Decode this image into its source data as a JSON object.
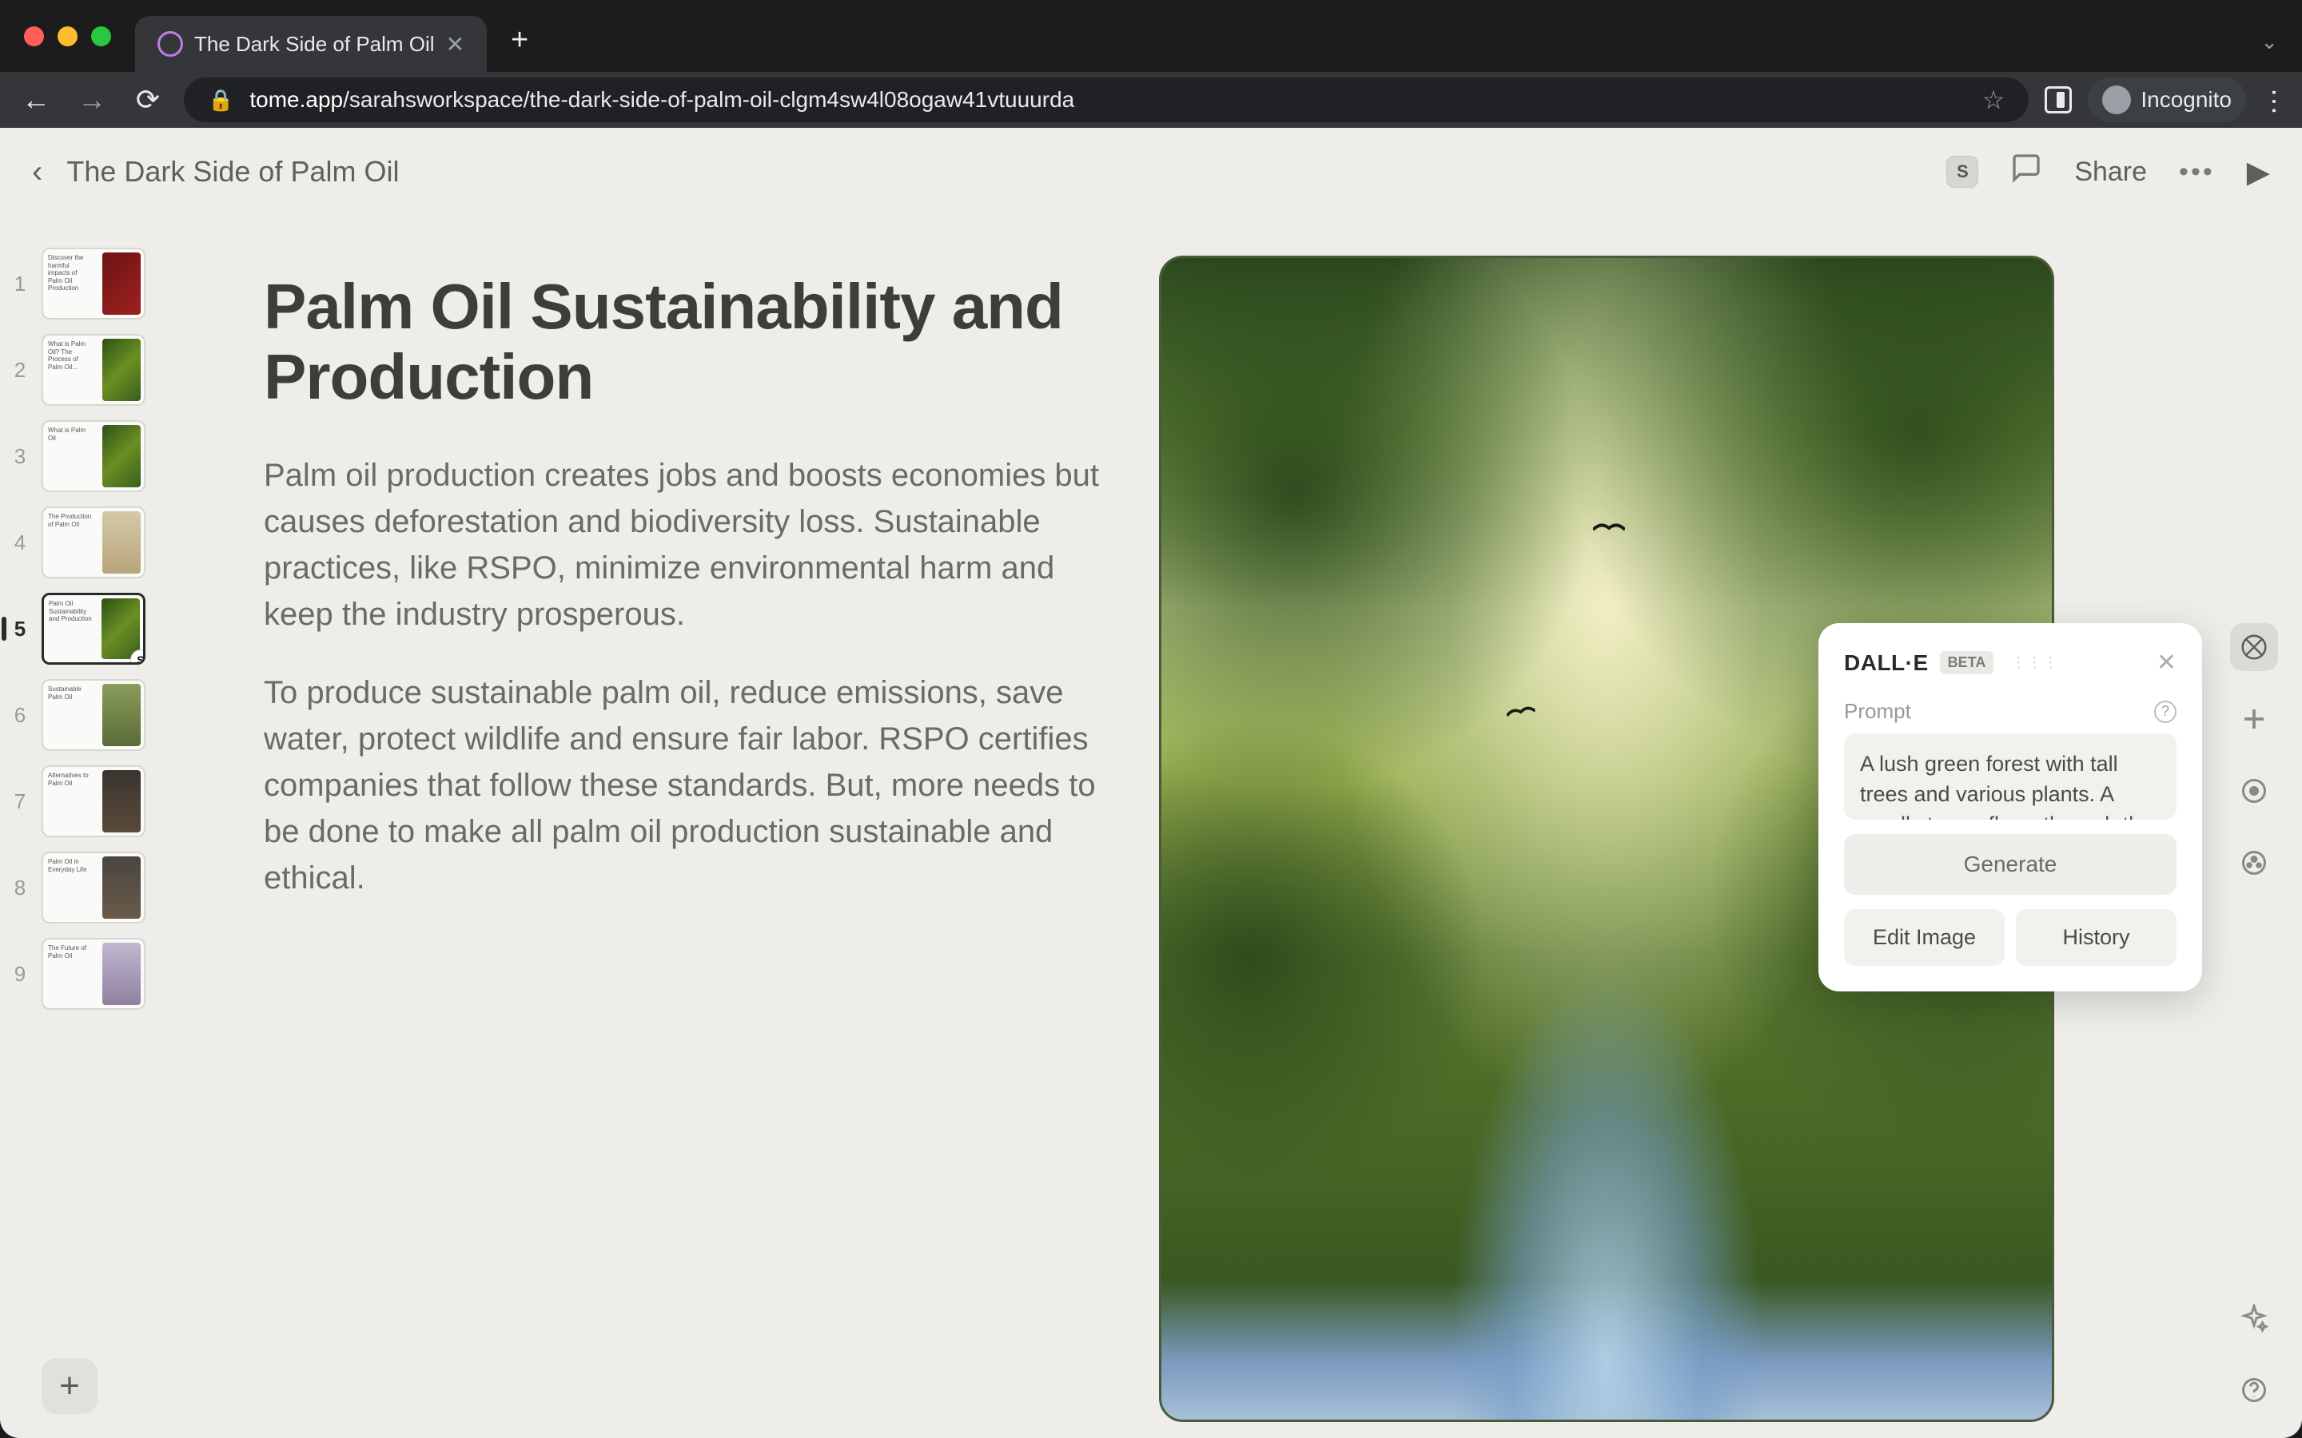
{
  "browser": {
    "tab_title": "The Dark Side of Palm Oil",
    "url_host": "tome.app",
    "url_path": "/sarahsworkspace/the-dark-side-of-palm-oil-clgm4sw4l08ogaw41vtuuurda",
    "incognito_label": "Incognito"
  },
  "app": {
    "doc_title": "The Dark Side of Palm Oil",
    "share_label": "Share",
    "avatar_initial": "S"
  },
  "slides": {
    "items": [
      {
        "num": "1",
        "title": "Discover the harmful impacts of Palm Oil Production",
        "img": "red"
      },
      {
        "num": "2",
        "title": "What is Palm Oil? The Process of Palm Oil...",
        "img": "green"
      },
      {
        "num": "3",
        "title": "What is Palm Oil",
        "img": "green"
      },
      {
        "num": "4",
        "title": "The Production of Palm Oil",
        "img": "sand"
      },
      {
        "num": "5",
        "title": "Palm Oil Sustainability and Production",
        "img": "green"
      },
      {
        "num": "6",
        "title": "Sustainable Palm Oil",
        "img": "farm"
      },
      {
        "num": "7",
        "title": "Alternatives to Palm Oil",
        "img": "bottle"
      },
      {
        "num": "8",
        "title": "Palm Oil in Everyday Life",
        "img": "shelf"
      },
      {
        "num": "9",
        "title": "The Future of Palm Oil",
        "img": "building"
      }
    ],
    "active_index": 4,
    "user_badge": "S"
  },
  "slide_content": {
    "heading": "Palm Oil Sustainability and Production",
    "para1": "Palm oil production creates jobs and boosts economies but causes deforestation and biodiversity loss. Sustainable practices, like RSPO, minimize environmental harm and keep the industry prosperous.",
    "para2": "To produce sustainable palm oil, reduce emissions, save water, protect wildlife and ensure fair labor. RSPO certifies companies that follow these standards. But, more needs to be done to make all palm oil production sustainable and ethical."
  },
  "dalle": {
    "title": "DALL·E",
    "beta": "BETA",
    "prompt_label": "Prompt",
    "prompt_value": "A lush green forest with tall trees and various plants. A small stream flows through the middle",
    "generate_label": "Generate",
    "edit_label": "Edit Image",
    "history_label": "History"
  }
}
